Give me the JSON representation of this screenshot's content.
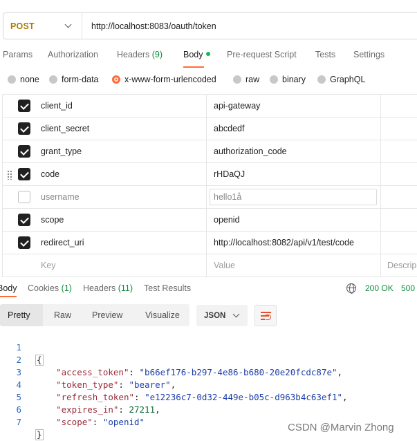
{
  "request": {
    "method": "POST",
    "url": "http://localhost:8083/oauth/token"
  },
  "tabs": {
    "params": "Params",
    "authorization": "Authorization",
    "headers": "Headers",
    "headers_count": "(9)",
    "body": "Body",
    "pre_request_script": "Pre-request Script",
    "tests": "Tests",
    "settings": "Settings"
  },
  "body_types": {
    "none": "none",
    "form_data": "form-data",
    "urlencoded": "x-www-form-urlencoded",
    "raw": "raw",
    "binary": "binary",
    "graphql": "GraphQL",
    "selected": "x-www-form-urlencoded"
  },
  "params": {
    "rows": [
      {
        "key": "client_id",
        "value": "api-gateway",
        "checked": true
      },
      {
        "key": "client_secret",
        "value": "abcdedf",
        "checked": true
      },
      {
        "key": "grant_type",
        "value": "authorization_code",
        "checked": true
      },
      {
        "key": "code",
        "value": "rHDaQJ",
        "checked": true
      },
      {
        "key": "username",
        "value": "hello1å",
        "checked": false
      },
      {
        "key": "scope",
        "value": "openid",
        "checked": true
      },
      {
        "key": "redirect_uri",
        "value": "http://localhost:8082/api/v1/test/code",
        "checked": true
      }
    ],
    "placeholder": {
      "key": "Key",
      "value": "Value",
      "description": "Descrip"
    }
  },
  "response": {
    "tabs": {
      "body": "Body",
      "cookies": "Cookies",
      "cookies_count": "(1)",
      "headers": "Headers",
      "headers_count": "(11)",
      "test_results": "Test Results"
    },
    "status": "200 OK",
    "time": "500",
    "views": {
      "pretty": "Pretty",
      "raw": "Raw",
      "preview": "Preview",
      "visualize": "Visualize"
    },
    "format": "JSON",
    "lines": [
      {
        "n": "1",
        "open": "{"
      },
      {
        "n": "2",
        "key": "\"access_token\"",
        "value": "\"b66ef176-b297-4e86-b680-20e20fcdc87e\"",
        "trail": ","
      },
      {
        "n": "3",
        "key": "\"token_type\"",
        "value": "\"bearer\"",
        "trail": ","
      },
      {
        "n": "4",
        "key": "\"refresh_token\"",
        "value": "\"e12236c7-0d32-449e-b05c-d963b4c63ef1\"",
        "trail": ","
      },
      {
        "n": "5",
        "key": "\"expires_in\"",
        "value": "27211",
        "trail": ","
      },
      {
        "n": "6",
        "key": "\"scope\"",
        "value": "\"openid\"",
        "trail": ""
      },
      {
        "n": "7",
        "close": "}"
      }
    ]
  },
  "watermark": "CSDN @Marvin Zhong",
  "colors": {
    "accent": "#ff6c37",
    "method": "#ad7a03",
    "success": "#0f8a3c",
    "json_key": "#9a2b39",
    "json_string": "#1c3fa8"
  }
}
